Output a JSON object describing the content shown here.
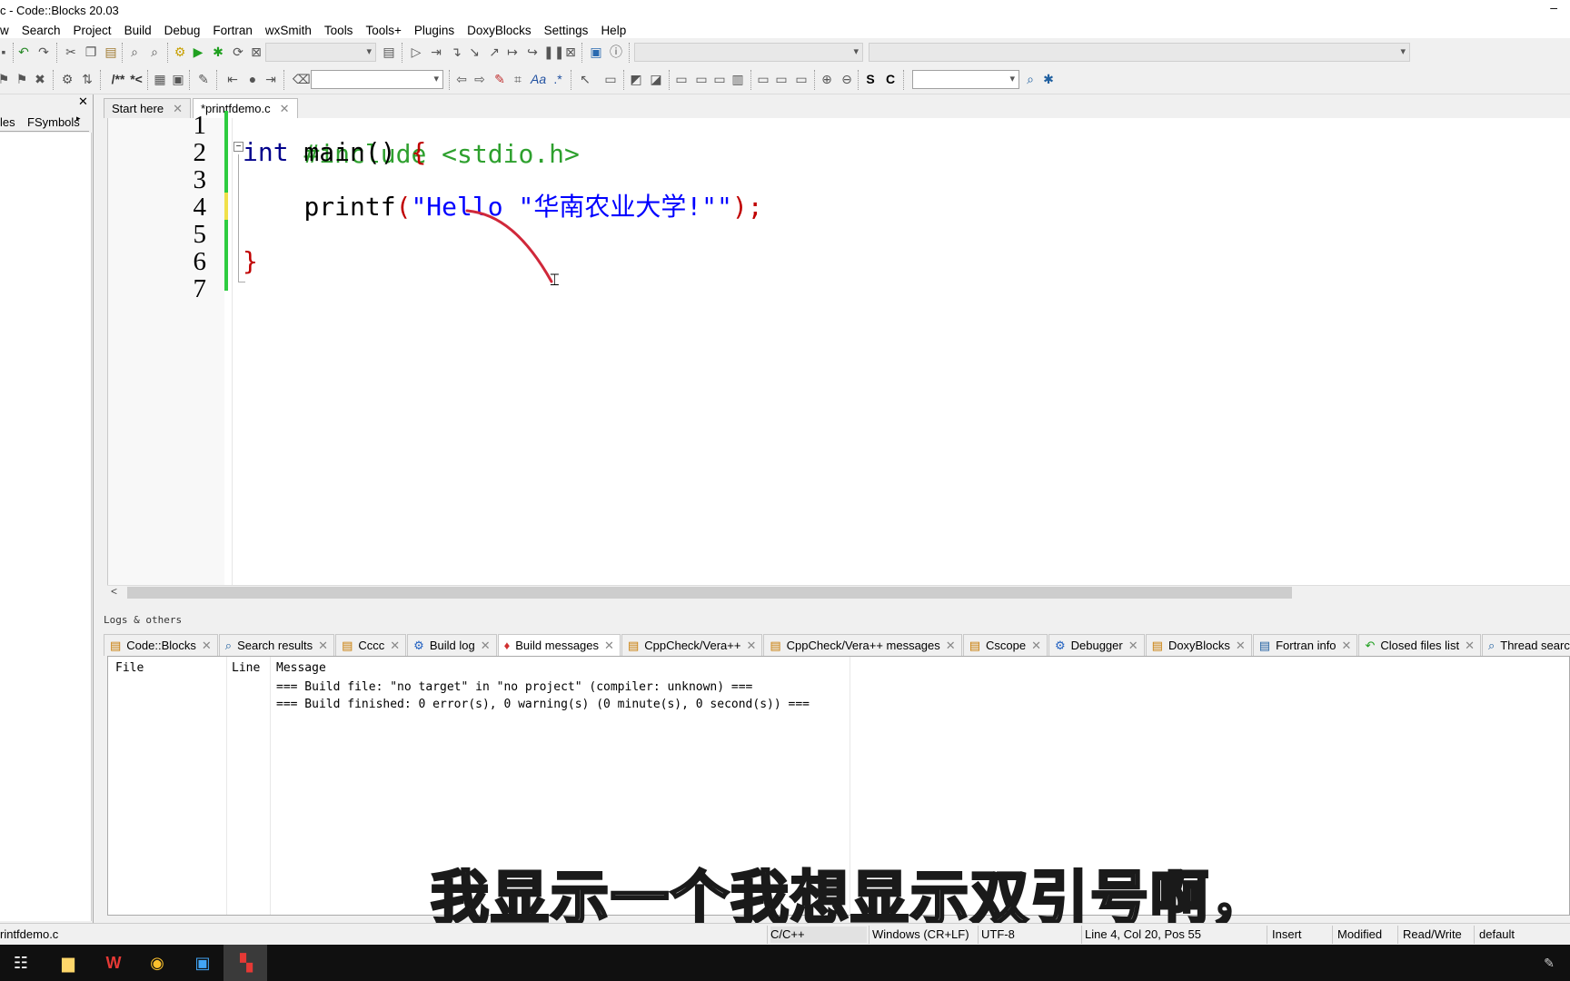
{
  "window": {
    "title": "c - Code::Blocks 20.03",
    "minimize_glyph": "–"
  },
  "menu": [
    "w",
    "Search",
    "Project",
    "Build",
    "Debug",
    "Fortran",
    "wxSmith",
    "Tools",
    "Tools+",
    "Plugins",
    "DoxyBlocks",
    "Settings",
    "Help"
  ],
  "toolbar2": {
    "comment_label": "/**",
    "uncomment_label": "*<",
    "s_label": "S",
    "c_label": "C"
  },
  "left_panel": {
    "tabs": [
      "les",
      "FSymbols"
    ],
    "close_glyph": "✕"
  },
  "editor_tabs": [
    {
      "label": "Start here",
      "active": false
    },
    {
      "label": "*printfdemo.c",
      "active": true
    }
  ],
  "editor": {
    "line_numbers": [
      "1",
      "2",
      "3",
      "4",
      "5",
      "6",
      "7"
    ],
    "line1_pp": "#include <stdio.h>",
    "line2_kw": "int",
    "line2_rest": " main() ",
    "line2_brace": "{",
    "line4_indent": "    ",
    "line4_fn": "printf",
    "line4_paren_open": "(",
    "line4_str": "\"Hello \"华南农业大学!\"\"",
    "line4_close": ");",
    "line6_brace": "}"
  },
  "logs": {
    "title": "Logs & others",
    "tabs": [
      {
        "label": "Code::Blocks",
        "icon": "doc-icon"
      },
      {
        "label": "Search results",
        "icon": "search-icon"
      },
      {
        "label": "Cccc",
        "icon": "doc-icon"
      },
      {
        "label": "Build log",
        "icon": "gear-icon"
      },
      {
        "label": "Build messages",
        "icon": "pin-icon",
        "active": true
      },
      {
        "label": "CppCheck/Vera++",
        "icon": "doc-icon"
      },
      {
        "label": "CppCheck/Vera++ messages",
        "icon": "doc-icon"
      },
      {
        "label": "Cscope",
        "icon": "doc-icon"
      },
      {
        "label": "Debugger",
        "icon": "gear-icon"
      },
      {
        "label": "DoxyBlocks",
        "icon": "doc-icon"
      },
      {
        "label": "Fortran info",
        "icon": "doc-icon"
      },
      {
        "label": "Closed files list",
        "icon": "undo-icon"
      },
      {
        "label": "Thread search",
        "icon": "search-icon"
      }
    ],
    "columns": [
      "File",
      "Line",
      "Message"
    ],
    "messages": [
      "=== Build file: \"no target\" in \"no project\" (compiler: unknown) ===",
      "=== Build finished: 0 error(s), 0 warning(s) (0 minute(s), 0 second(s)) ==="
    ]
  },
  "subtitle": "我显示一个我想显示双引号啊，",
  "status": {
    "file": "rintfdemo.c",
    "language": "C/C++",
    "eol": "Windows (CR+LF)",
    "encoding": "UTF-8",
    "position": "Line 4, Col 20, Pos 55",
    "mode": "Insert",
    "modified": "Modified",
    "access": "Read/Write",
    "profile": "default"
  },
  "colors": {
    "accent_green": "#2ecc40",
    "string_blue": "#0000ff",
    "keyword_navy": "#00008b",
    "preproc_green": "#2ea02e",
    "operator_red": "#c00000"
  }
}
